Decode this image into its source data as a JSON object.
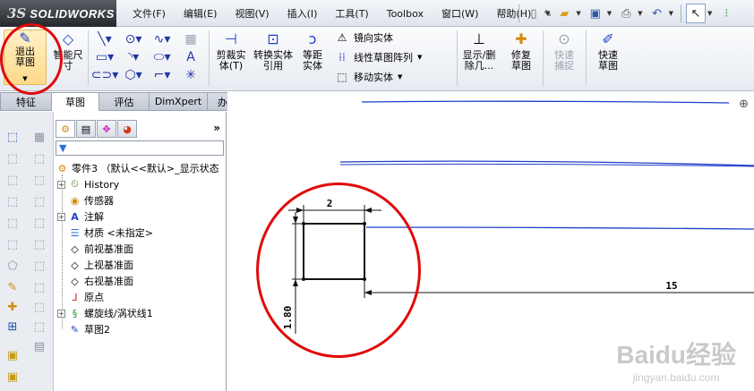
{
  "app": {
    "logo_ds": "3S",
    "logo_name": "SOLIDWORKS"
  },
  "menu": [
    "文件(F)",
    "编辑(E)",
    "视图(V)",
    "插入(I)",
    "工具(T)",
    "Toolbox",
    "窗口(W)",
    "帮助(H)"
  ],
  "command_manager": {
    "exit_sketch": "退出草图",
    "smart_dimension": "智能尺寸",
    "trim": "剪裁实体(T)",
    "convert": "转换实体引用",
    "offset": "等距实体",
    "mirror": "镜向实体",
    "linear_pattern": "线性草图阵列",
    "move": "移动实体",
    "show_delete": "显示/删除几...",
    "repair": "修复草图",
    "quick_snap": "快速捕捉",
    "rapid_sketch": "快速草图"
  },
  "tabs": [
    {
      "label": "特征",
      "active": false
    },
    {
      "label": "草图",
      "active": true
    },
    {
      "label": "评估",
      "active": false
    },
    {
      "label": "DimXpert",
      "active": false
    },
    {
      "label": "办公室产品",
      "active": false
    }
  ],
  "feature_tree": {
    "root": "零件3 （默认<<默认>_显示状态",
    "items": [
      "History",
      "传感器",
      "注解",
      "材质 <未指定>",
      "前视基准面",
      "上视基准面",
      "右视基准面",
      "原点",
      "螺旋线/涡状线1",
      "草图2"
    ]
  },
  "sketch": {
    "dim_width": "2",
    "dim_height": "1.80",
    "dim_long": "15"
  },
  "watermark": {
    "line1": "Baidu经验",
    "line2": "jingyan.baidu.com"
  },
  "colors": {
    "accent_blue": "#1f3fc8",
    "annotation_red": "#e10a0a"
  }
}
